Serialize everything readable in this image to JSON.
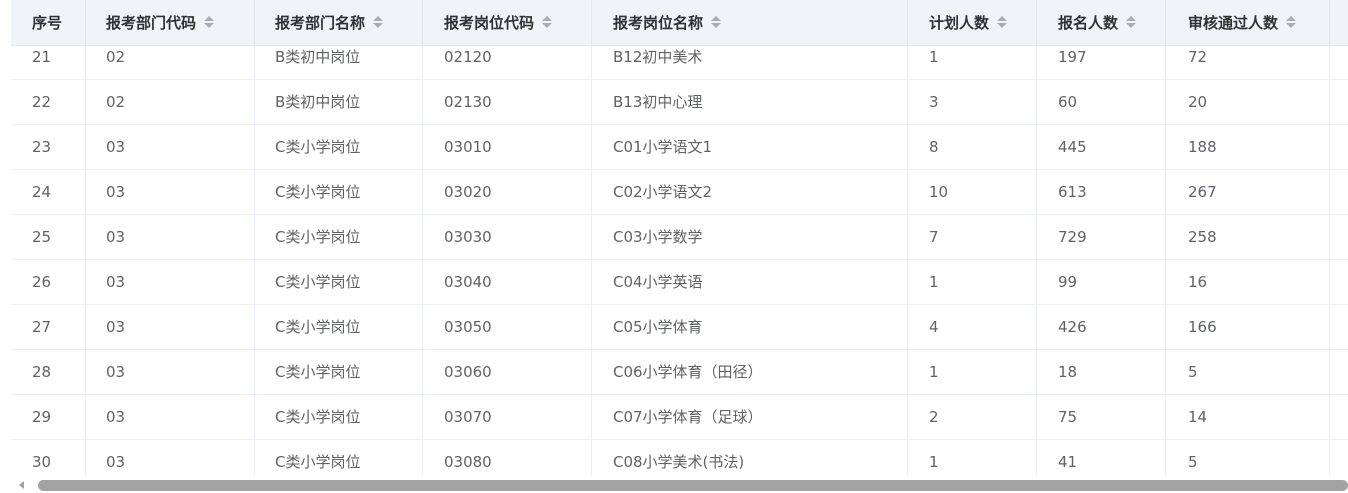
{
  "table": {
    "headers": [
      "序号",
      "报考部门代码",
      "报考部门名称",
      "报考岗位代码",
      "报考岗位名称",
      "计划人数",
      "报名人数",
      "审核通过人数"
    ],
    "rows": [
      [
        "21",
        "02",
        "B类初中岗位",
        "02120",
        "B12初中美术",
        "1",
        "197",
        "72"
      ],
      [
        "22",
        "02",
        "B类初中岗位",
        "02130",
        "B13初中心理",
        "3",
        "60",
        "20"
      ],
      [
        "23",
        "03",
        "C类小学岗位",
        "03010",
        "C01小学语文1",
        "8",
        "445",
        "188"
      ],
      [
        "24",
        "03",
        "C类小学岗位",
        "03020",
        "C02小学语文2",
        "10",
        "613",
        "267"
      ],
      [
        "25",
        "03",
        "C类小学岗位",
        "03030",
        "C03小学数学",
        "7",
        "729",
        "258"
      ],
      [
        "26",
        "03",
        "C类小学岗位",
        "03040",
        "C04小学英语",
        "1",
        "99",
        "16"
      ],
      [
        "27",
        "03",
        "C类小学岗位",
        "03050",
        "C05小学体育",
        "4",
        "426",
        "166"
      ],
      [
        "28",
        "03",
        "C类小学岗位",
        "03060",
        "C06小学体育（田径）",
        "1",
        "18",
        "5"
      ],
      [
        "29",
        "03",
        "C类小学岗位",
        "03070",
        "C07小学体育（足球）",
        "2",
        "75",
        "14"
      ],
      [
        "30",
        "03",
        "C类小学岗位",
        "03080",
        "C08小学美术(书法)",
        "1",
        "41",
        "5"
      ]
    ]
  },
  "icons": {
    "sort": "sort-caret-icon",
    "scroll_left": "scroll-left-arrow-icon"
  },
  "colors": {
    "header_bg": "#f0f3f8",
    "header_text": "#303133",
    "cell_text": "#606266",
    "border": "#ebeef5",
    "scroll_thumb": "#a3a3a3"
  }
}
